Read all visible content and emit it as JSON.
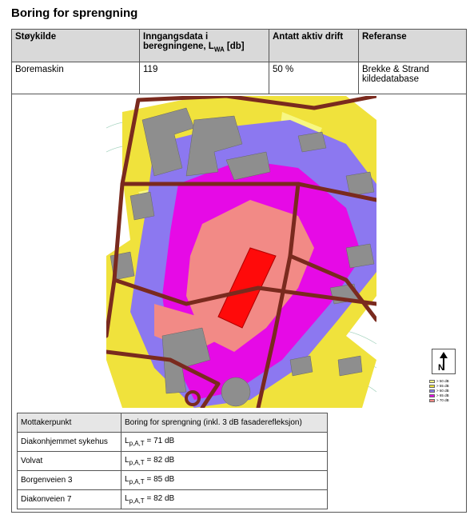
{
  "title": "Boring for sprengning",
  "source_table": {
    "headers": {
      "col1": "Støykilde",
      "col2_line1": "Inngangsdata i",
      "col2_line2": "beregningene, L",
      "col2_sub": "WA",
      "col2_unit": " [db]",
      "col3": "Antatt aktiv drift",
      "col4": "Referanse"
    },
    "row": {
      "source": "Boremaskin",
      "input": "119",
      "active": "50 %",
      "ref_line1": "Brekke & Strand",
      "ref_line2": "kildedatabase"
    }
  },
  "map": {
    "north_label": "N",
    "north_icon": "north-arrow-icon",
    "legend": [
      {
        "label": "> 50 dB",
        "color": "#f7f782"
      },
      {
        "label": "> 55 dB",
        "color": "#f0e23c"
      },
      {
        "label": "> 60 dB",
        "color": "#8c78f0"
      },
      {
        "label": "> 65 dB",
        "color": "#e60ae6"
      },
      {
        "label": "> 70 dB",
        "color": "#f28a86"
      }
    ],
    "colors": {
      "road": "#7a2a1e",
      "building": "#8e8e8e",
      "zone55": "#f0e23c",
      "zone60": "#8c78f0",
      "zone65": "#e60ae6",
      "zone70": "#f28a86",
      "source": "#ff0a0a",
      "terrain": "#a7d4c0"
    }
  },
  "receiver_table": {
    "header_col1": "Mottakerpunkt",
    "header_col2": "Boring for sprengning (inkl. 3 dB fasaderefleksjon)",
    "rows": [
      {
        "name": "Diakonhjemmet sykehus",
        "value": "= 71 dB"
      },
      {
        "name": "Volvat",
        "value": "= 82 dB"
      },
      {
        "name": "Borgenveien 3",
        "value": "= 85 dB"
      },
      {
        "name": "Diakonveien 7",
        "value": "= 82 dB"
      }
    ],
    "level_symbol": "L",
    "level_sub": "p,A,T"
  }
}
